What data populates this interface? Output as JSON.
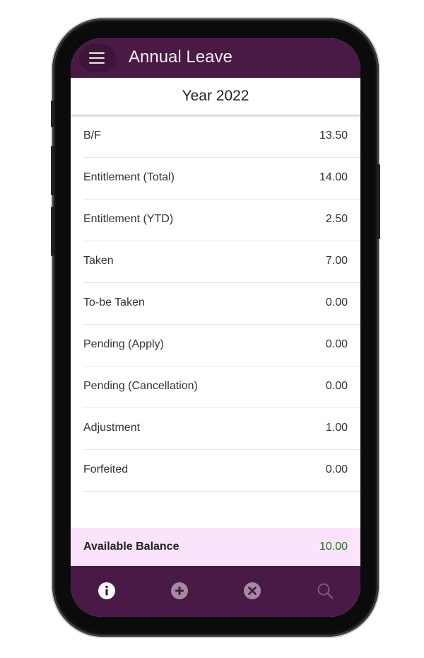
{
  "header": {
    "title": "Annual Leave",
    "menu_icon": "hamburger-menu-icon"
  },
  "year": {
    "label": "Year 2022"
  },
  "rows": [
    {
      "label": "B/F",
      "value": "13.50"
    },
    {
      "label": "Entitlement (Total)",
      "value": "14.00"
    },
    {
      "label": "Entitlement (YTD)",
      "value": "2.50"
    },
    {
      "label": "Taken",
      "value": "7.00"
    },
    {
      "label": "To-be Taken",
      "value": "0.00"
    },
    {
      "label": "Pending (Apply)",
      "value": "0.00"
    },
    {
      "label": "Pending (Cancellation)",
      "value": "0.00"
    },
    {
      "label": "Adjustment",
      "value": "1.00"
    },
    {
      "label": "Forfeited",
      "value": "0.00"
    }
  ],
  "balance": {
    "label": "Available Balance",
    "value": "10.00"
  },
  "bottom_nav": {
    "items": [
      {
        "icon": "info-icon",
        "active": true
      },
      {
        "icon": "add-circle-icon",
        "active": false
      },
      {
        "icon": "cancel-circle-icon",
        "active": false
      },
      {
        "icon": "search-icon",
        "active": false
      }
    ]
  },
  "colors": {
    "primary": "#4a1a46",
    "balance_background": "#fbe3fb",
    "balance_value": "#1a7a1a"
  }
}
